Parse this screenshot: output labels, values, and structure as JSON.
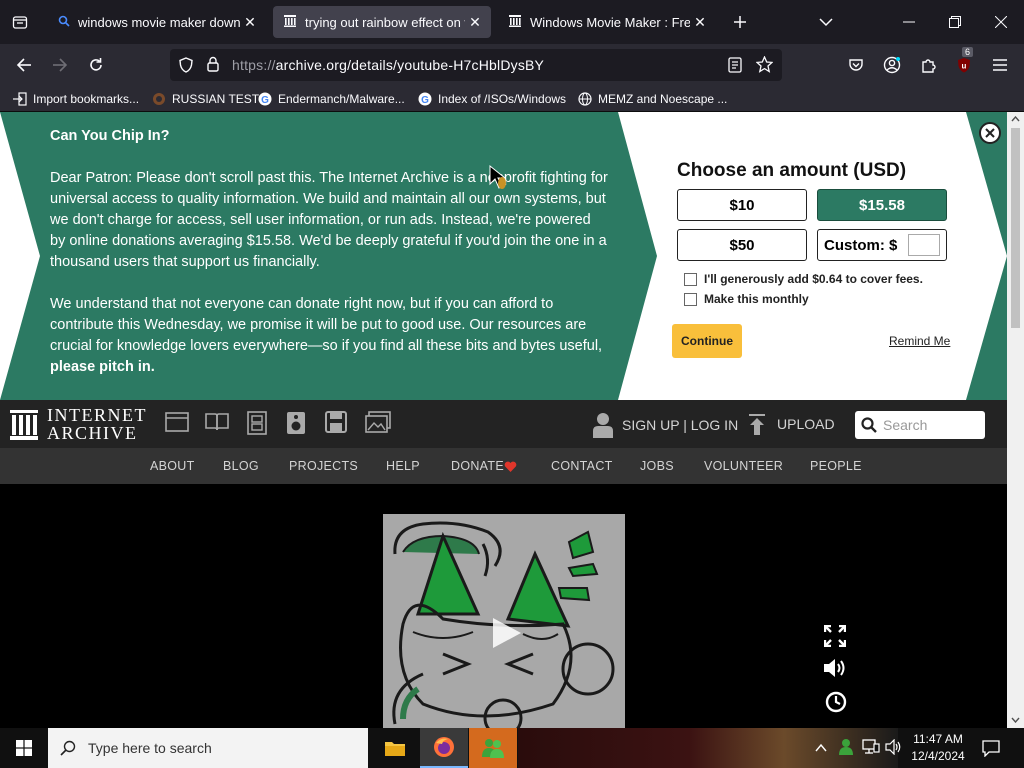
{
  "browser": {
    "tabs": [
      {
        "title": "windows movie maker download",
        "active": false
      },
      {
        "title": "trying out rainbow effect on windows",
        "active": true
      },
      {
        "title": "Windows Movie Maker : Free Download",
        "active": false
      }
    ],
    "url_prefix": "https://",
    "url_main": "archive.org/details/youtube-H7cHblDysBY",
    "extension_badge": "6",
    "bookmarks": [
      {
        "label": "Import bookmarks...",
        "icon": "import-icon"
      },
      {
        "label": "RUSSIAN TEST",
        "icon": "globe-icon"
      },
      {
        "label": "Endermanch/Malware...",
        "icon": "google-icon"
      },
      {
        "label": "Index of /ISOs/Windows",
        "icon": "google-icon"
      },
      {
        "label": "MEMZ and Noescape ...",
        "icon": "globe-icon"
      }
    ]
  },
  "donation": {
    "heading": "Can You Chip In?",
    "paragraph1": "Dear Patron: Please don't scroll past this. The Internet Archive is a nonprofit fighting for universal access to quality information. We build and maintain all our own systems, but we don't charge for access, sell user information, or run ads. Instead, we're powered by online donations averaging $15.58. We'd be deeply grateful if you'd join the one in a thousand users that support us financially.",
    "paragraph2": "We understand that not everyone can donate right now, but if you can afford to contribute this Wednesday, we promise it will be put to good use. Our resources are crucial for knowledge lovers everywhere—so if you find all these bits and bytes useful,",
    "paragraph2_bold": "please pitch in.",
    "choose_title": "Choose an amount (USD)",
    "amounts": [
      "$10",
      "$15.58",
      "$50"
    ],
    "selected_amount": "$15.58",
    "custom_label": "Custom: $",
    "fee_label": "I'll generously add $0.64 to cover fees.",
    "monthly_label": "Make this monthly",
    "continue_label": "Continue",
    "remind_label": "Remind Me",
    "green": "#2c7a63",
    "button_yellow": "#f9bf3b"
  },
  "ia": {
    "logo_line1": "INTERNET",
    "logo_line2": "ARCHIVE",
    "signup": "SIGN UP | LOG IN",
    "upload": "UPLOAD",
    "search_placeholder": "Search",
    "nav": [
      "ABOUT",
      "BLOG",
      "PROJECTS",
      "HELP",
      "DONATE",
      "CONTACT",
      "JOBS",
      "VOLUNTEER",
      "PEOPLE"
    ]
  },
  "taskbar": {
    "search_placeholder": "Type here to search",
    "time": "11:47 AM",
    "date": "12/4/2024"
  }
}
